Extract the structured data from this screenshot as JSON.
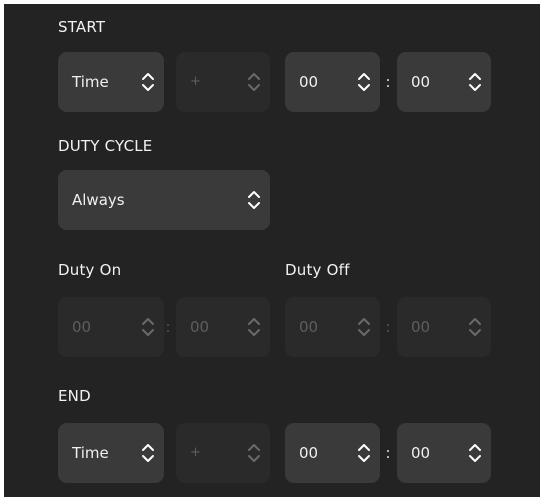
{
  "start": {
    "label": "START",
    "type_value": "Time",
    "offset_placeholder": "+",
    "hours": "00",
    "separator": ":",
    "minutes": "00"
  },
  "duty_cycle": {
    "label": "DUTY CYCLE",
    "value": "Always"
  },
  "duty_on": {
    "label": "Duty On",
    "hours": "00",
    "separator": ":",
    "minutes": "00"
  },
  "duty_off": {
    "label": "Duty Off",
    "hours": "00",
    "separator": ":",
    "minutes": "00"
  },
  "end": {
    "label": "END",
    "type_value": "Time",
    "offset_placeholder": "+",
    "hours": "00",
    "separator": ":",
    "minutes": "00"
  },
  "icons": {
    "stepper": "chevron-up-down-icon"
  },
  "colors": {
    "panel_bg": "#232323",
    "field_bg": "#3a3a3a",
    "field_disabled_bg": "#2a2a2a",
    "text": "#f0f0f0",
    "text_disabled": "#5e5e5e"
  }
}
